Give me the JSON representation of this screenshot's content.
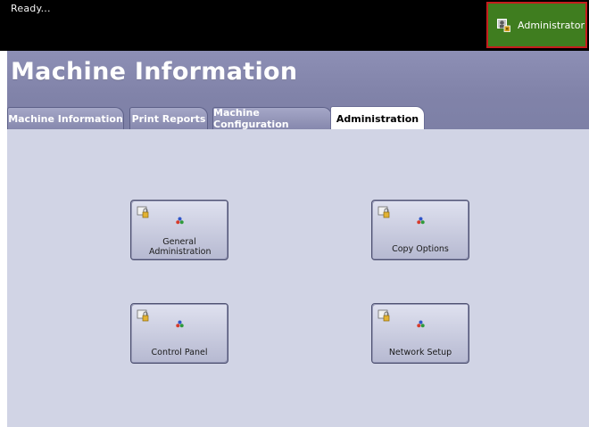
{
  "status": {
    "text": "Ready..."
  },
  "user": {
    "label": "Administrator"
  },
  "page": {
    "title": "Machine Information"
  },
  "tabs": [
    {
      "label": "Machine Information",
      "active": false
    },
    {
      "label": "Print Reports",
      "active": false
    },
    {
      "label": "Machine Configuration",
      "active": false
    },
    {
      "label": "Administration",
      "active": true
    }
  ],
  "tiles": [
    {
      "label": "General Administration"
    },
    {
      "label": "Copy Options"
    },
    {
      "label": "Control Panel"
    },
    {
      "label": "Network Setup"
    }
  ],
  "colors": {
    "topbar": "#000000",
    "admin_button": "#3f7d1f",
    "admin_border": "#c51d1d",
    "header": "#8183a9",
    "content_bg": "#d1d4e5"
  },
  "icons": {
    "admin": "administrator-icon",
    "tile_lock": "lock-icon",
    "tile_feature": "feature-dots-icon"
  }
}
